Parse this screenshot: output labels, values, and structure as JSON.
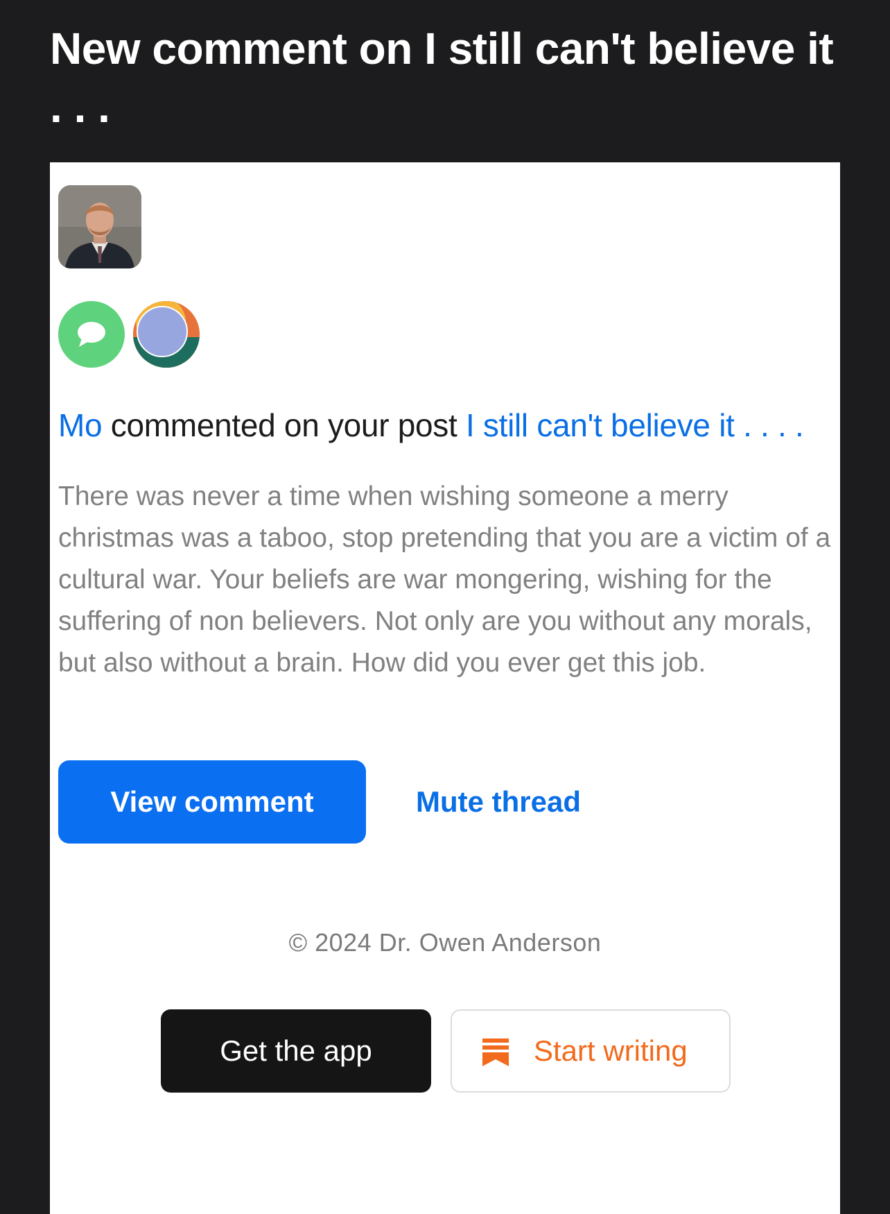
{
  "header": {
    "title": "New comment on I still can't believe it . . ."
  },
  "notification": {
    "author_name": "Mo",
    "action_text": " commented on your post ",
    "post_title": "I still can't believe it . . . .",
    "comment_text": "There was never a time when wishing someone a merry christmas was a taboo, stop pretending that you are a victim of a cultural war. Your beliefs are war mongering, wishing for the suffering of non believers. Not only are you without any morals, but also without a brain. How did you ever get this job."
  },
  "actions": {
    "view_comment_label": "View comment",
    "mute_thread_label": "Mute thread"
  },
  "footer": {
    "copyright": "© 2024 Dr. Owen Anderson",
    "get_app_label": "Get the app",
    "start_writing_label": "Start writing"
  },
  "colors": {
    "background": "#1c1c1e",
    "link_blue": "#0a6fe5",
    "primary_button": "#0a6ff0",
    "comment_badge": "#5fd27d",
    "writing_accent": "#f26a1b"
  },
  "icons": {
    "comment_badge": "speech-bubble-icon",
    "publication_badge": "abstract-avatar-icon",
    "writing": "bookmark-icon"
  }
}
